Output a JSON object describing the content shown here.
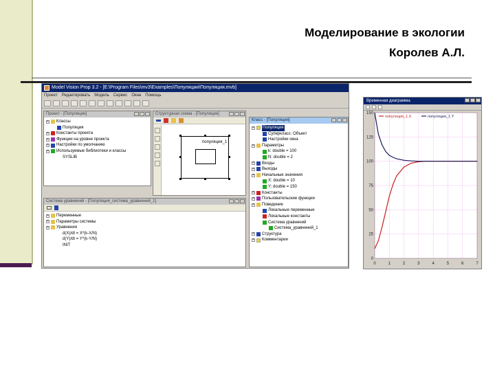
{
  "slide": {
    "title": "Моделирование в экологии",
    "author": "Королев А.Л."
  },
  "app": {
    "title": "Model Vision Prop 3.2 - [E:\\Program Files\\mv3\\Examples\\Популяции\\Популяция.mvb]",
    "menu": [
      "Проект",
      "Редактировать",
      "Модель",
      "Сервис",
      "Окна",
      "Помощь"
    ],
    "project_window": {
      "title": "Проект - [Популяции]",
      "items": [
        {
          "label": "Классы",
          "level": 0,
          "icon": "folder-icon",
          "color": "folder"
        },
        {
          "label": "Популяция",
          "level": 1,
          "icon": "class-icon",
          "color": "blue"
        },
        {
          "label": "Константы проекта",
          "level": 0,
          "icon": "constant-icon",
          "color": "red"
        },
        {
          "label": "Функции на уровне проекта",
          "level": 0,
          "icon": "function-icon",
          "color": "purple"
        },
        {
          "label": "Настройки по умолчанию",
          "level": 0,
          "icon": "settings-icon",
          "color": "blue"
        },
        {
          "label": "Используемые библиотеки и классы",
          "level": 0,
          "icon": "library-icon",
          "color": "green"
        },
        {
          "label": "SYSLIB",
          "level": 1,
          "icon": "library-file-icon",
          "color": "none"
        }
      ]
    },
    "structure_window": {
      "title": "Структурная схема - [Популяции]",
      "block_label": "популяция_1"
    },
    "equations_window": {
      "title": "Система уравнений - [Популяция_система_уравнений_1]",
      "items": [
        {
          "label": "Переменные",
          "level": 0
        },
        {
          "label": "Параметры системы",
          "level": 0
        },
        {
          "label": "Уравнения",
          "level": 0
        },
        {
          "label": "d(X)/dt = X*(k-X/N)",
          "level": 1
        },
        {
          "label": "d(Y)/dt = Y*(k-Y/N)",
          "level": 1
        },
        {
          "label": "INIT",
          "level": 1
        }
      ]
    },
    "class_window": {
      "title": "Класс - [Популяция]",
      "items": [
        {
          "label": "Популяция",
          "level": 0,
          "selected": true,
          "color": "yellow"
        },
        {
          "label": "Суперкласс: Объект",
          "level": 1,
          "color": "blue"
        },
        {
          "label": "Настройки окна",
          "level": 1,
          "color": "blue"
        },
        {
          "label": "Параметры",
          "level": 0,
          "color": "folder"
        },
        {
          "label": "k: double = 100",
          "level": 1,
          "color": "green"
        },
        {
          "label": "N: double = 2",
          "level": 1,
          "color": "green"
        },
        {
          "label": "Входы",
          "level": 0,
          "color": "blue"
        },
        {
          "label": "Выходы",
          "level": 0,
          "color": "blue"
        },
        {
          "label": "Начальные значения",
          "level": 0,
          "color": "folder"
        },
        {
          "label": "X: double = 10",
          "level": 1,
          "color": "green"
        },
        {
          "label": "Y: double = 150",
          "level": 1,
          "color": "green"
        },
        {
          "label": "Константы",
          "level": 0,
          "color": "red"
        },
        {
          "label": "Пользовательские функции",
          "level": 0,
          "color": "purple"
        },
        {
          "label": "Поведение",
          "level": 0,
          "color": "folder"
        },
        {
          "label": "Локальные переменные",
          "level": 1,
          "color": "blue"
        },
        {
          "label": "Локальные константы",
          "level": 1,
          "color": "red"
        },
        {
          "label": "Система уравнений",
          "level": 1,
          "color": "green"
        },
        {
          "label": "Система_уравнений_1",
          "level": 2,
          "color": "green"
        },
        {
          "label": "Структура",
          "level": 0,
          "color": "blue"
        },
        {
          "label": "Комментарии",
          "level": 0,
          "color": "yellow"
        }
      ]
    }
  },
  "time_diagram": {
    "title": "Временная диаграмма",
    "legend": [
      "популяция_1.X",
      "популяция_1.Y"
    ],
    "colors": {
      "x_series": "#c81e1e",
      "y_series": "#1a1a5a",
      "grid": "#e06ad6"
    }
  },
  "chart_data": {
    "type": "line",
    "title": "Временная диаграмма",
    "xlabel": "",
    "ylabel": "",
    "xlim": [
      0,
      7
    ],
    "ylim": [
      0,
      150
    ],
    "x_ticks": [
      "0",
      "1",
      "2",
      "3",
      "4",
      "5",
      "6",
      "7"
    ],
    "y_ticks": [
      "0",
      "25",
      "50",
      "75",
      "100",
      "125",
      "150"
    ],
    "grid": true,
    "legend_position": "top",
    "series": [
      {
        "name": "популяция_1.X",
        "color": "#c81e1e",
        "x": [
          0,
          0.25,
          0.5,
          0.75,
          1,
          1.25,
          1.5,
          2,
          2.5,
          3,
          3.5,
          4,
          5,
          6,
          7
        ],
        "y": [
          10,
          18,
          32,
          48,
          64,
          76,
          85,
          94,
          98,
          99.5,
          100,
          100,
          100,
          100,
          100
        ]
      },
      {
        "name": "популяция_1.Y",
        "color": "#1a1a5a",
        "x": [
          0,
          0.25,
          0.5,
          0.75,
          1,
          1.25,
          1.5,
          2,
          2.5,
          3,
          3.5,
          4,
          5,
          6,
          7
        ],
        "y": [
          150,
          128,
          117,
          110,
          106,
          104,
          102.5,
          101,
          100.3,
          100,
          100,
          100,
          100,
          100,
          100
        ]
      }
    ]
  }
}
